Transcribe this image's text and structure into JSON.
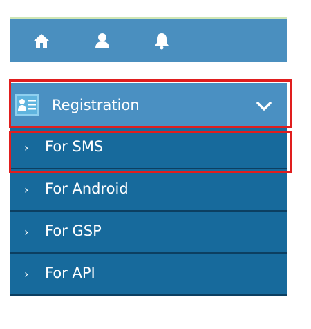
{
  "topbar": {
    "icons": [
      "home-icon",
      "user-icon",
      "bell-icon"
    ],
    "accent_color": "#cfe6b6",
    "background_color": "#4a8fbf"
  },
  "menu": {
    "header": {
      "label": "Registration",
      "icon": "registration-card-icon",
      "toggle_icon": "chevron-down-icon",
      "background_color": "#4a90c2"
    },
    "items": [
      {
        "label": "For SMS",
        "arrow": "›"
      },
      {
        "label": "For Android",
        "arrow": "›"
      },
      {
        "label": "For GSP",
        "arrow": "›"
      },
      {
        "label": "For API",
        "arrow": "›"
      }
    ],
    "item_background_color": "#176a9c"
  },
  "highlights": {
    "color": "#e01e1e"
  }
}
